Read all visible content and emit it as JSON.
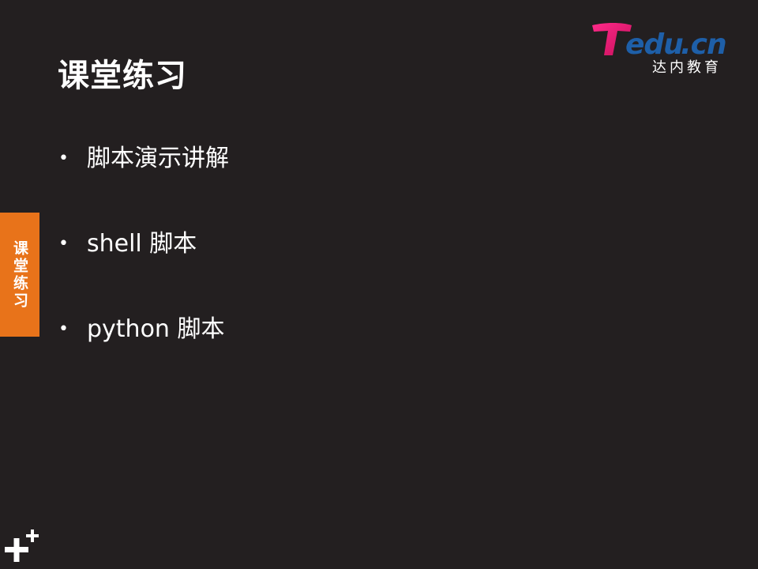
{
  "slide": {
    "title": "课堂练习",
    "side_tab": "课堂练习",
    "bullets": [
      {
        "text": "脚本演示讲解"
      },
      {
        "text": "shell 脚本"
      },
      {
        "text": "python 脚本"
      }
    ]
  },
  "logo": {
    "wordmark": "Tedu.cn",
    "subtitle": "达内教育",
    "colors": {
      "pink": "#e2146f",
      "blue": "#1e5fa8"
    }
  },
  "theme": {
    "background": "#231f20",
    "accent": "#e8731a",
    "text": "#ffffff"
  },
  "icons": {
    "bullet": "bullet-dot-icon",
    "corner": "plus-mark-icon"
  }
}
